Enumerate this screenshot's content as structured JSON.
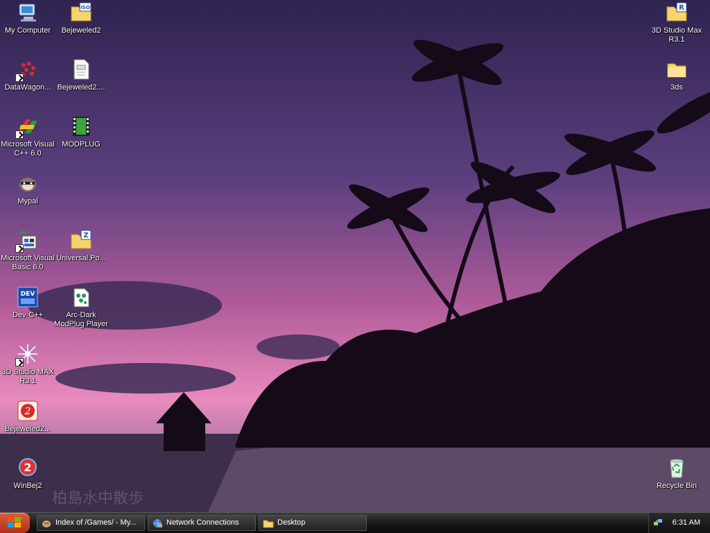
{
  "desktop": {
    "icons": [
      {
        "label": "My Computer",
        "icon": "computer-icon"
      },
      {
        "label": "Bejeweled2",
        "icon": "folder-iso-icon"
      },
      {
        "label": "DataWagon...",
        "icon": "datawagon-icon"
      },
      {
        "label": "Bejeweled2....",
        "icon": "document-icon"
      },
      {
        "label": "Microsoft Visual\nC++ 6.0",
        "icon": "visual-cpp-icon"
      },
      {
        "label": "MODPLUG",
        "icon": "film-icon"
      },
      {
        "label": "Mypal",
        "icon": "mypal-icon"
      },
      {
        "label": "Microsoft Visual\nBasic 6.0",
        "icon": "visual-basic-icon"
      },
      {
        "label": "Universal.Po...",
        "icon": "folder-zip-icon"
      },
      {
        "label": "Dev-C++",
        "icon": "devcpp-icon"
      },
      {
        "label": "Arc-Dark\nModPlug Player",
        "icon": "modplug-player-icon"
      },
      {
        "label": "3D Studio MAX\nR3.1",
        "icon": "3dsmax-icon"
      },
      {
        "label": "Bejeweled2...",
        "icon": "bejeweled-icon"
      },
      {
        "label": "WinBej2",
        "icon": "winbej-icon"
      },
      {
        "label": "3D Studio Max\nR3.1",
        "icon": "folder-r-icon"
      },
      {
        "label": "3ds",
        "icon": "folder-icon"
      },
      {
        "label": "Recycle Bin",
        "icon": "recycle-bin-icon"
      }
    ],
    "watermark": "柏島水中散歩"
  },
  "taskbar": {
    "start_icon": "windows-logo-icon",
    "buttons": [
      {
        "label": "Index of /Games/ - My...",
        "icon": "browser-icon"
      },
      {
        "label": "Network Connections",
        "icon": "network-icon"
      },
      {
        "label": "Desktop",
        "icon": "folder-icon"
      }
    ],
    "clock": "6:31 AM",
    "tray_icon": "network-tray-icon"
  },
  "colors": {
    "sky_top": "#3c2a5e",
    "sky_pink": "#e77bb4",
    "sea": "#3a2a4a",
    "taskbar": "#1a1a1a"
  }
}
